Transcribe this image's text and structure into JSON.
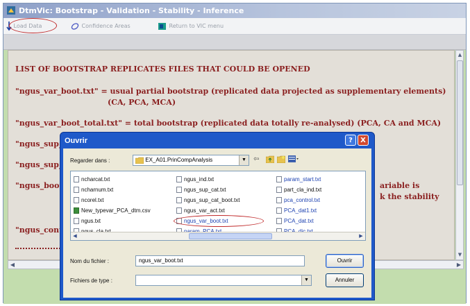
{
  "window": {
    "title": "DtmVic: Bootstrap - Validation - Stability - Inference"
  },
  "toolbar": {
    "load_data": "Load Data",
    "confidence_areas": "Confidence Areas",
    "return_vic": "Return to VIC menu"
  },
  "content": {
    "heading": "LIST  OF  BOOTSTRAP  REPLICATES  FILES THAT COULD BE OPENED",
    "line1a": "\"ngus_var_boot.txt\"  =  usual partial bootstrap  (replicated data projected as supplementary  elements)",
    "line1b": "(CA, PCA, MCA)",
    "line2": "\"ngus_var_boot_total.txt\"  =  total bootstrap (replicated data totally re-analysed) (PCA, CA and MCA)",
    "line3": "\"ngus_sup_",
    "line4": "\"ngus_sup_",
    "line5": "\"ngus_boot",
    "line5r1": "ariable is",
    "line5r2": "k the stability",
    "line6": "\"ngus_conti"
  },
  "dialog": {
    "title": "Ouvrir",
    "help": "?",
    "close": "X",
    "look_in_label": "Regarder dans :",
    "look_in_value": "EX_A01.PrinCompAnalysis",
    "files_col1": [
      "ncharcat.txt",
      "ncharnum.txt",
      "ncorel.txt",
      "New_typevar_PCA_dtm.csv",
      "ngus.txt",
      "ngus_cla.txt"
    ],
    "files_col2": [
      "ngus_ind.txt",
      "ngus_sup_cat.txt",
      "ngus_sup_cat_boot.txt",
      "ngus_var_act.txt",
      "ngus_var_boot.txt",
      "param_PCA.txt"
    ],
    "files_col3": [
      "param_start.txt",
      "part_cla_ind.txt",
      "pca_control.txt",
      "PCA_dat1.txt",
      "PCA_dat.txt",
      "PCA_dic.txt"
    ],
    "filename_label": "Nom du fichier :",
    "filename_value": "ngus_var_boot.txt",
    "filetype_label": "Fichiers de type :",
    "filetype_value": "",
    "open_button": "Ouvrir",
    "cancel_button": "Annuler"
  }
}
